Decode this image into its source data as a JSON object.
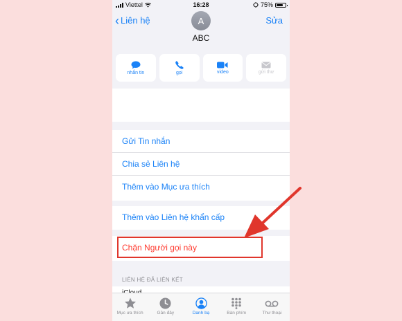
{
  "status_bar": {
    "carrier": "Viettel",
    "time": "16:28",
    "battery": "75%",
    "battery_level": 0.75
  },
  "nav": {
    "back_label": "Liên hệ",
    "edit_label": "Sửa"
  },
  "contact": {
    "initial": "A",
    "name": "ABC"
  },
  "actions": [
    {
      "label": "nhắn tin",
      "icon": "message-icon",
      "enabled": true
    },
    {
      "label": "gọi",
      "icon": "phone-icon",
      "enabled": true
    },
    {
      "label": "video",
      "icon": "video-icon",
      "enabled": true
    },
    {
      "label": "gửi thư",
      "icon": "mail-icon",
      "enabled": false
    }
  ],
  "options": [
    "Gửi Tin nhắn",
    "Chia sẻ Liên hệ",
    "Thêm vào Mục ưa thích"
  ],
  "emergency_option": "Thêm vào Liên hệ khẩn cấp",
  "block_option": "Chặn Người gọi này",
  "linked_section": {
    "header": "LIÊN HỆ ĐÃ LIÊN KẾT",
    "first_item": "iCloud"
  },
  "tabs": [
    {
      "label": "Mục ưa thích",
      "icon": "star-icon",
      "active": false
    },
    {
      "label": "Gần đây",
      "icon": "clock-icon",
      "active": false
    },
    {
      "label": "Danh bạ",
      "icon": "person-circle-icon",
      "active": true
    },
    {
      "label": "Bàn phím",
      "icon": "keypad-icon",
      "active": false
    },
    {
      "label": "Thư thoại",
      "icon": "voicemail-icon",
      "active": false
    }
  ],
  "colors": {
    "accent": "#1a82f7",
    "destructive": "#ff3b30",
    "annotation": "#e0362c",
    "background": "#fbdedd"
  }
}
